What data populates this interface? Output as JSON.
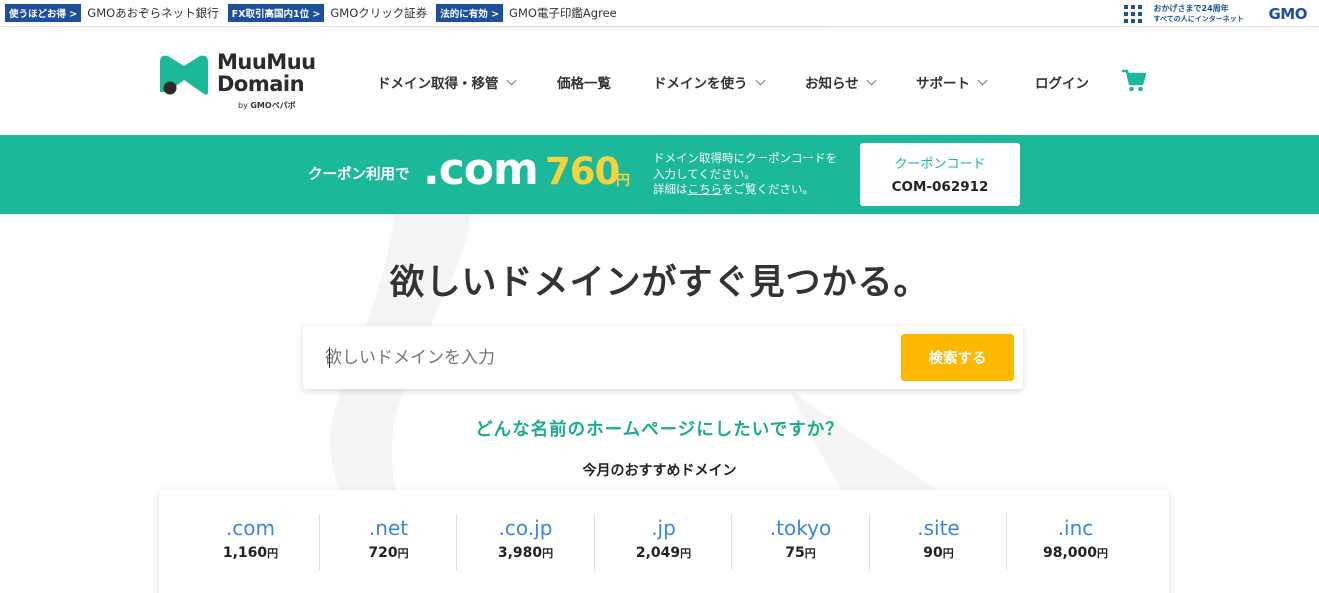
{
  "gmo_bar": {
    "promos": [
      {
        "tag": "使うほどお得 >",
        "site": "GMOあおぞらネット銀行"
      },
      {
        "tag": "FX取引高国内1位 >",
        "site": "GMOクリック証券"
      },
      {
        "tag": "法的に有効 >",
        "site": "GMO電子印鑑Agree"
      }
    ],
    "slogan_line1": "おかげさまで24周年",
    "slogan_line2": "すべての人にインターネット",
    "logo_text": "GMO"
  },
  "header": {
    "logo_line1": "MuuMuu",
    "logo_line2": "Domain",
    "logo_by": "by",
    "logo_by_brand": "GMOペパボ",
    "nav": [
      {
        "label": "ドメイン取得・移管",
        "has_dropdown": true
      },
      {
        "label": "価格一覧",
        "has_dropdown": false
      },
      {
        "label": "ドメインを使う",
        "has_dropdown": true
      },
      {
        "label": "お知らせ",
        "has_dropdown": true
      },
      {
        "label": "サポート",
        "has_dropdown": true
      },
      {
        "label": "ログイン",
        "has_dropdown": false
      }
    ],
    "cart_icon": "cart-icon"
  },
  "coupon": {
    "lead": "クーポン利用で",
    "tld": ".com",
    "price": "760",
    "yen": "円",
    "note_line1": "ドメイン取得時にクーポンコードを",
    "note_line2": "入力してください。",
    "note_pre": "詳細は",
    "note_link": "こちら",
    "note_post": "をご覧ください。",
    "code_label": "クーポンコード",
    "code_value": "COM-062912"
  },
  "hero": {
    "title": "欲しいドメインがすぐ見つかる。",
    "search_placeholder": "欲しいドメインを入力",
    "search_button": "検索する",
    "question": "どんな名前のホームページにしたいですか？",
    "recommend_title": "今月のおすすめドメイン"
  },
  "domains": [
    {
      "tld": ".com",
      "price": "1,160",
      "unit": "円"
    },
    {
      "tld": ".net",
      "price": "720",
      "unit": "円"
    },
    {
      "tld": ".co.jp",
      "price": "3,980",
      "unit": "円"
    },
    {
      "tld": ".jp",
      "price": "2,049",
      "unit": "円"
    },
    {
      "tld": ".tokyo",
      "price": "75",
      "unit": "円"
    },
    {
      "tld": ".site",
      "price": "90",
      "unit": "円"
    },
    {
      "tld": ".inc",
      "price": "98,000",
      "unit": "円"
    }
  ],
  "colors": {
    "brand_green": "#1bb99a",
    "accent_yellow": "#ffb800",
    "price_yellow": "#f6d23c",
    "tld_blue": "#3a86e0",
    "gmo_blue": "#1e4f9c"
  }
}
